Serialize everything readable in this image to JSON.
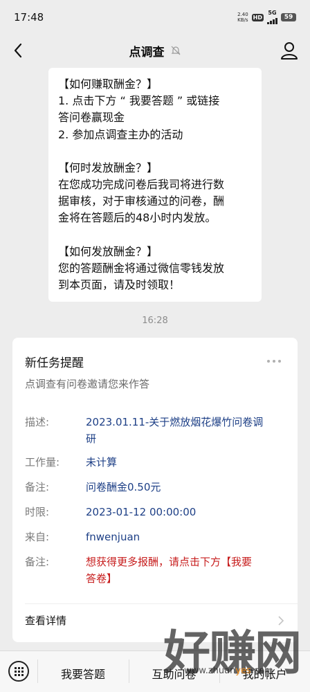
{
  "status_bar": {
    "time": "17:48",
    "net_speed_value": "2.40",
    "net_speed_unit": "KB/s",
    "hd": "HD",
    "network": "5G",
    "battery": "59"
  },
  "header": {
    "title": "点调查"
  },
  "message": {
    "lines": [
      "【如何赚取酬金？】",
      "1. 点击下方 “ 我要答题 ” 或链接",
      "答问卷赢现金",
      "2. 参加点调查主办的活动",
      "",
      "【何时发放酬金？】",
      "在您成功完成问卷后我司将进行数",
      "据审核，对于审核通过的问卷，酬",
      "金将在答题后的48小时内发放。",
      "",
      "【如何发放酬金？】",
      "您的答题酬金将通过微信零钱发放",
      "到本页面，请及时领取！"
    ]
  },
  "timestamp": "16:28",
  "card": {
    "title": "新任务提醒",
    "subtitle": "点调查有问卷邀请您来作答",
    "rows": [
      {
        "label": "描述:",
        "value_line1": "2023.01.11-关于燃放烟花爆竹问卷调",
        "value_line2": "研"
      },
      {
        "label": "工作量:",
        "value": "未计算"
      },
      {
        "label": "备注:",
        "value": "问卷酬金0.50元"
      },
      {
        "label": "时限:",
        "value": "2023-01-12 00:00:00"
      },
      {
        "label": "来自:",
        "value": "fnwenjuan"
      },
      {
        "label": "备注:",
        "value_line1": "想获得更多报酬，请点击下方【我要",
        "value_line2": "答卷】"
      }
    ],
    "detail_link": "查看详情"
  },
  "bottom_menu": {
    "item1": "我要答题",
    "item2": "互助问卷",
    "item3": "我的帐户"
  },
  "watermark": {
    "main": "好赚网",
    "url_prefix": "www.zhuan",
    "url_accent": "yes",
    "url_suffix": ".com"
  },
  "colors": {
    "link_blue": "#1d3f86",
    "remark_red": "#c71d1d",
    "background": "#ededed"
  }
}
